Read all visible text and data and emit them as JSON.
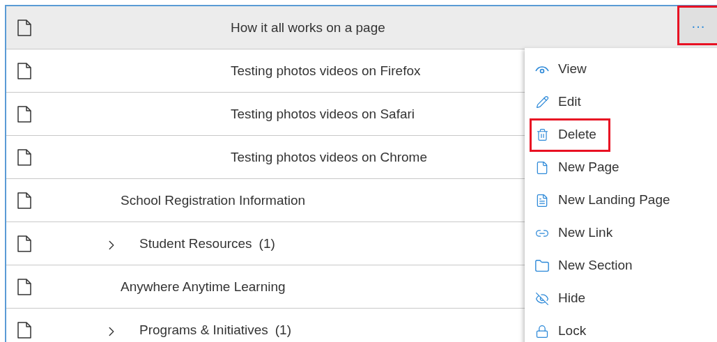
{
  "tree": [
    {
      "children": [
        {
          "children": [
            {
              "label": "How it all works on a page",
              "selected": true
            },
            {
              "label": "Testing photos videos on Firefox",
              "selected": false
            },
            {
              "label": "Testing photos videos on Safari",
              "selected": false
            },
            {
              "label": "Testing photos videos on Chrome",
              "selected": false
            }
          ]
        }
      ]
    },
    {
      "label": "School Registration Information",
      "selected": false
    },
    {
      "label": "Student Resources",
      "count": "(1)",
      "expanded": false,
      "selected": false
    },
    {
      "label": "Anywhere Anytime Learning",
      "selected": false
    },
    {
      "label": "Programs & Initiatives",
      "count": "(1)",
      "expanded": false,
      "selected": false
    }
  ],
  "more_button": {
    "label": "···",
    "highlighted": true
  },
  "context_menu": [
    {
      "kind": "view",
      "label": "View",
      "highlighted": false
    },
    {
      "kind": "edit",
      "label": "Edit",
      "highlighted": false
    },
    {
      "kind": "delete",
      "label": "Delete",
      "highlighted": true
    },
    {
      "kind": "page",
      "label": "New Page",
      "highlighted": false
    },
    {
      "kind": "landing",
      "label": "New Landing Page",
      "highlighted": false
    },
    {
      "kind": "link",
      "label": "New Link",
      "highlighted": false
    },
    {
      "kind": "section",
      "label": "New Section",
      "highlighted": false
    },
    {
      "kind": "hide",
      "label": "Hide",
      "highlighted": false
    },
    {
      "kind": "lock",
      "label": "Lock",
      "highlighted": false
    }
  ]
}
